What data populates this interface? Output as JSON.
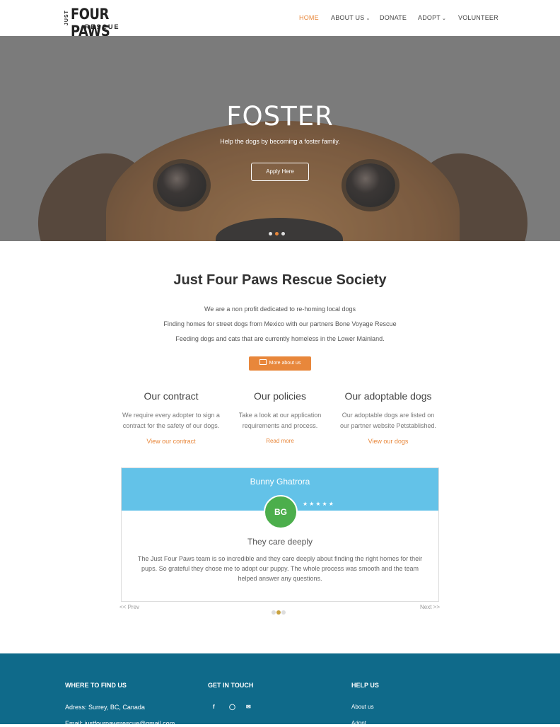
{
  "header": {
    "logo": {
      "just": "JUST",
      "four_paws": "FOUR PAWS",
      "rescue": "RESCUE"
    },
    "nav": [
      {
        "label": "HOME",
        "active": true
      },
      {
        "label": "ABOUT US",
        "dropdown": true
      },
      {
        "label": "DONATE"
      },
      {
        "label": "ADOPT",
        "dropdown": true
      },
      {
        "label": "VOLUNTEER"
      }
    ]
  },
  "hero": {
    "title": "FOSTER",
    "subtitle": "Help the dogs by becoming a foster family.",
    "button": "Apply Here",
    "slides": 3,
    "active_slide": 2
  },
  "society": {
    "title": "Just Four Paws Rescue Society",
    "lines": [
      "We are a non profit dedicated to re-homing local dogs",
      "Finding homes for street dogs from Mexico with our partners Bone Voyage Rescue",
      "Feeding dogs and cats that are currently homeless in the Lower Mainland."
    ],
    "more_button": "More about us"
  },
  "columns": [
    {
      "title": "Our contract",
      "text1": "We require every adopter to sign a",
      "text2": "contract for the safety of our dogs.",
      "link": "View our contract"
    },
    {
      "title": "Our policies",
      "text1": "Take a look at our application",
      "text2": "requirements and process.",
      "link": "Read more"
    },
    {
      "title": "Our adoptable dogs",
      "text1": "Our adoptable dogs are listed on",
      "text2": "our partner website Petstablished.",
      "link": "View our dogs"
    }
  ],
  "testimonial": {
    "name": "Bunny Ghatrora",
    "initials": "BG",
    "stars": "★★★★★",
    "title": "They care deeply",
    "body": "The Just Four Paws team is so incredible and they care deeply about finding the right homes for their pups. So grateful they chose me to adopt our puppy. The whole process was smooth and the team helped answer any questions.",
    "prev": "<< Prev",
    "next": "Next >>",
    "dots": 3,
    "active_dot": 2
  },
  "footer": {
    "find_title": "WHERE TO FIND US",
    "address": "Adress: Surrey, BC, Canada",
    "email": "Email: justfourpawsrescue@gmail.com",
    "touch_title": "GET IN TOUCH",
    "social": [
      "facebook-icon",
      "instagram-icon",
      "email-icon"
    ],
    "help_title": "HELP US",
    "help_links": [
      "About us",
      "Adopt"
    ]
  },
  "colors": {
    "accent": "#e8873b",
    "band": "#63c2e8",
    "avatar": "#4cae4c",
    "footer": "#0f6a8a"
  }
}
